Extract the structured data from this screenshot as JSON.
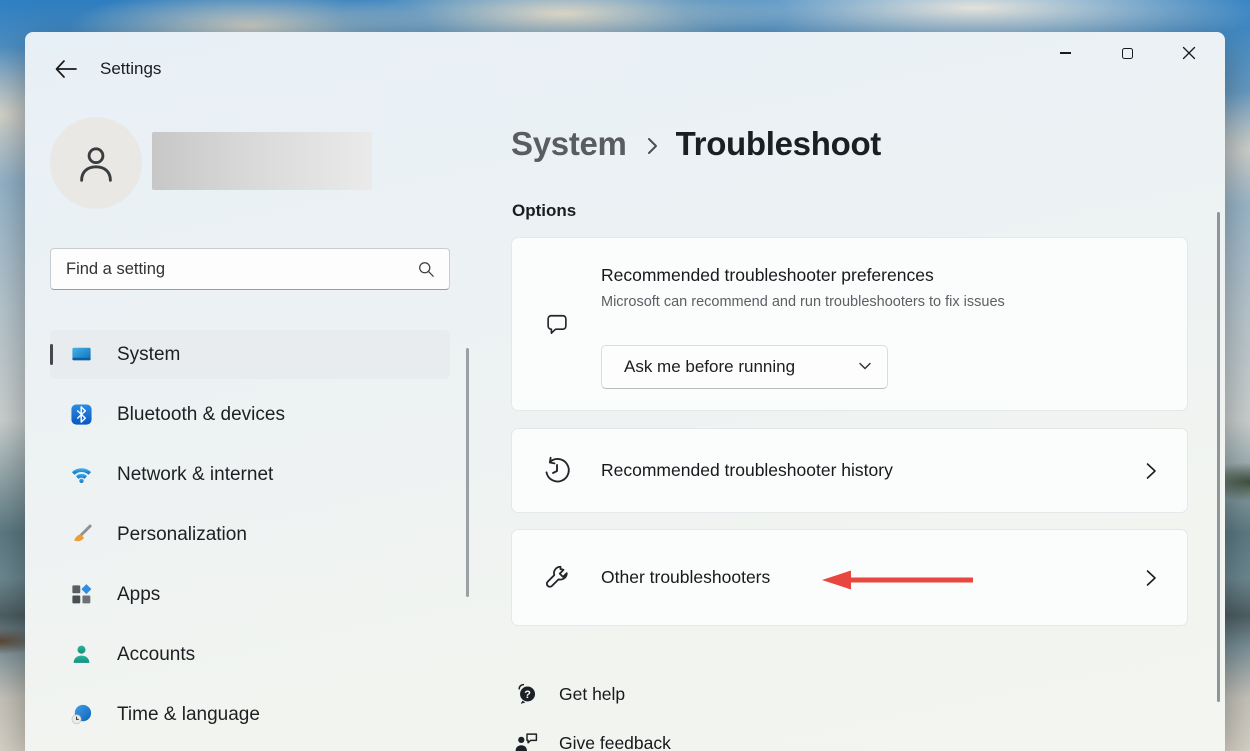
{
  "window": {
    "title": "Settings"
  },
  "titlebar": {
    "controls": [
      {
        "name": "minimize",
        "icon": "minimize-icon"
      },
      {
        "name": "maximize",
        "icon": "maximize-icon"
      },
      {
        "name": "close",
        "icon": "close-icon"
      }
    ]
  },
  "sidebar": {
    "search": {
      "placeholder": "Find a setting",
      "icon": "search-icon"
    },
    "items": [
      {
        "label": "System",
        "icon": "system-icon",
        "selected": true
      },
      {
        "label": "Bluetooth & devices",
        "icon": "bluetooth-icon",
        "selected": false
      },
      {
        "label": "Network & internet",
        "icon": "network-icon",
        "selected": false
      },
      {
        "label": "Personalization",
        "icon": "personalization-icon",
        "selected": false
      },
      {
        "label": "Apps",
        "icon": "apps-icon",
        "selected": false
      },
      {
        "label": "Accounts",
        "icon": "accounts-icon",
        "selected": false
      },
      {
        "label": "Time & language",
        "icon": "time-language-icon",
        "selected": false
      }
    ]
  },
  "header": {
    "breadcrumb": {
      "root": "System",
      "current": "Troubleshoot"
    }
  },
  "main": {
    "section_title": "Options",
    "cards": [
      {
        "icon": "comment-icon",
        "title": "Recommended troubleshooter preferences",
        "subtitle": "Microsoft can recommend and run troubleshooters to fix issues",
        "dropdown": {
          "value": "Ask me before running",
          "icon": "chevron-down-icon"
        }
      },
      {
        "icon": "history-icon",
        "title": "Recommended troubleshooter history",
        "trailing_icon": "chevron-right-icon"
      },
      {
        "icon": "wrench-icon",
        "title": "Other troubleshooters",
        "trailing_icon": "chevron-right-icon",
        "annotation": "red arrow pointing at this row"
      }
    ],
    "links": [
      {
        "label": "Get help",
        "icon": "get-help-icon"
      },
      {
        "label": "Give feedback",
        "icon": "give-feedback-icon"
      }
    ]
  },
  "colors": {
    "annotation_arrow": "#e8473f",
    "nav_selected_indicator": "#45494d",
    "window_top_sky": "#2e7fc2"
  }
}
